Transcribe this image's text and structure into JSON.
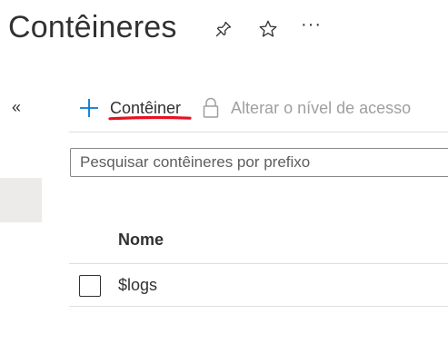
{
  "header": {
    "title": "Contêineres",
    "more_label": "···"
  },
  "nav": {
    "collapse_label": "«"
  },
  "toolbar": {
    "add_label": "Contêiner",
    "access_label": "Alterar o nível de acesso"
  },
  "search": {
    "placeholder": "Pesquisar contêineres por prefixo",
    "value": ""
  },
  "table": {
    "columns": [
      "Nome"
    ],
    "rows": [
      {
        "name": "$logs",
        "checked": false
      }
    ]
  },
  "colors": {
    "accent": "#0078d4",
    "annotation_red": "#e81123",
    "disabled_text": "#a19f9d",
    "divider": "#e1dfdd",
    "panel_gray": "#edebe9"
  },
  "icons": {
    "pin": "pin-icon",
    "star": "star-icon",
    "add": "add-icon",
    "lock": "lock-icon"
  }
}
